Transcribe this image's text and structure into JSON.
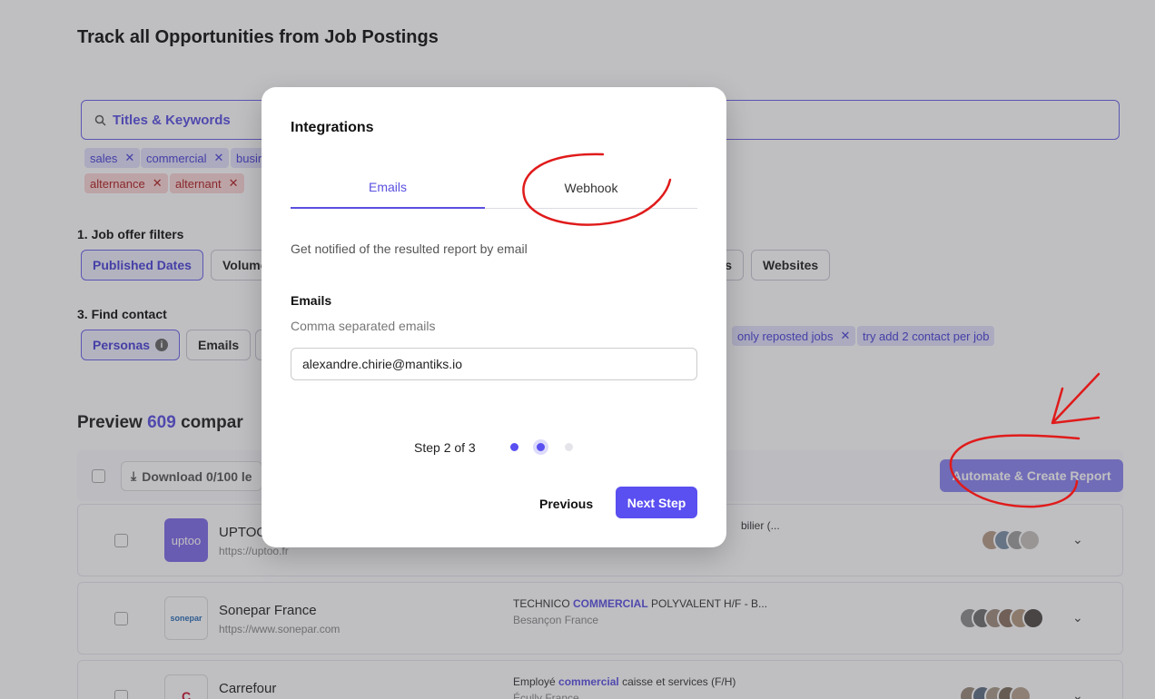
{
  "page": {
    "title": "Track all Opportunities from Job Postings"
  },
  "search": {
    "placeholder": "Titles & Keywords"
  },
  "keyword_chips": [
    {
      "label": "sales",
      "color": "#e2e0fb"
    },
    {
      "label": "commercial",
      "color": "#e2e0fb"
    },
    {
      "label": "busir",
      "color": "#e2e0fb"
    }
  ],
  "exclude_chips": [
    {
      "label": "alternance",
      "color": "#fbd6d6"
    },
    {
      "label": "alternant",
      "color": "#fbd6d6"
    }
  ],
  "filters": {
    "job_offer_label": "1. Job offer filters",
    "published_dates": "Published Dates",
    "volume": "Volume",
    "partial": "s",
    "websites": "Websites"
  },
  "contact": {
    "label": "3. Find contact",
    "personas": "Personas",
    "emails": "Emails",
    "chip_reposted": "only reposted jobs",
    "chip_contact": "try add 2 contact per job"
  },
  "preview": {
    "prefix": "Preview",
    "count": "609",
    "suffix": "compar"
  },
  "toolbar": {
    "download": "Download 0/100 le",
    "automate": "Automate & Create Report"
  },
  "rows": [
    {
      "logo": "uptoo",
      "name": "UPTOO",
      "url": "https://uptoo.fr",
      "job_prefix": "",
      "job_hl": "",
      "job_suffix": "bilier (...",
      "location": ""
    },
    {
      "logo": "sonepar",
      "name": "Sonepar France",
      "url": "https://www.sonepar.com",
      "job_prefix": "TECHNICO ",
      "job_hl": "COMMERCIAL",
      "job_suffix": " POLYVALENT H/F - B...",
      "location": "Besançon France"
    },
    {
      "logo": "C",
      "name": "Carrefour",
      "url": "",
      "job_prefix": "Employé ",
      "job_hl": "commercial",
      "job_suffix": " caisse et services (F/H)",
      "location": "Écully France"
    }
  ],
  "modal": {
    "title": "Integrations",
    "tabs": {
      "emails": "Emails",
      "webhook": "Webhook"
    },
    "description": "Get notified of the resulted report by email",
    "field_label": "Emails",
    "field_help": "Comma separated emails",
    "field_value": "alexandre.chirie@mantiks.io",
    "step_text": "Step 2 of 3",
    "previous": "Previous",
    "next": "Next Step"
  },
  "colors": {
    "accent": "#5a4ff0",
    "annotation": "#e01b1b"
  }
}
